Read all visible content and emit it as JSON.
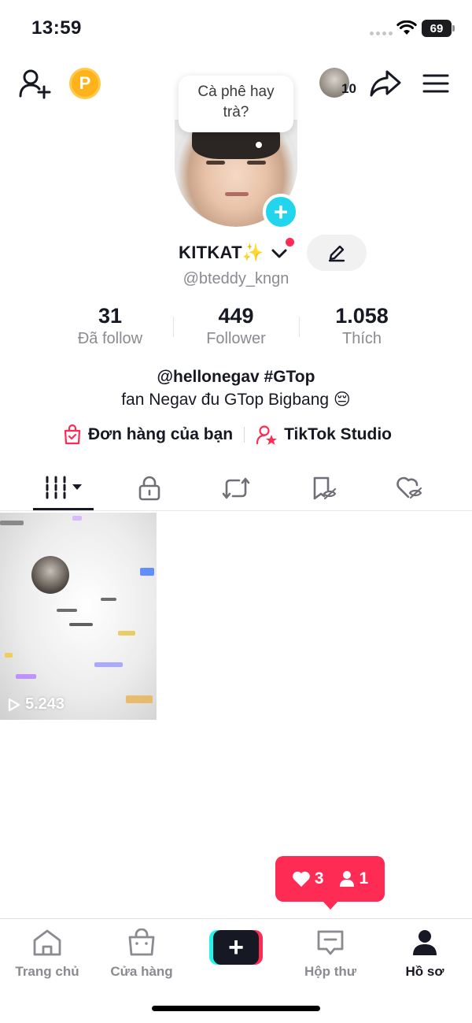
{
  "status_bar": {
    "time": "13:59",
    "battery": "69"
  },
  "top_bar": {
    "avatar_count": "10",
    "coin_letter": "P"
  },
  "bubble": {
    "line1": "Cà phê hay",
    "line2": "trà?"
  },
  "profile": {
    "display_name": "KITKAT✨",
    "handle": "@bteddy_kngn",
    "stats": [
      {
        "value": "31",
        "label": "Đã follow"
      },
      {
        "value": "449",
        "label": "Follower"
      },
      {
        "value": "1.058",
        "label": "Thích"
      }
    ],
    "bio_line1": "@hellonegav #GTop",
    "bio_line2": "fan Negav đu GTop Bigbang 😔",
    "links": {
      "orders": "Đơn hàng của bạn",
      "studio": "TikTok Studio"
    }
  },
  "video": {
    "views": "5.243"
  },
  "notification": {
    "likes": "3",
    "followers": "1"
  },
  "nav": {
    "home": "Trang chủ",
    "shop": "Cửa hàng",
    "create": "+",
    "inbox": "Hộp thư",
    "profile": "Hồ sơ"
  },
  "colors": {
    "accent": "#fe2c55",
    "cyan": "#25f4ee",
    "text": "#161823",
    "muted": "#8a8b91"
  }
}
